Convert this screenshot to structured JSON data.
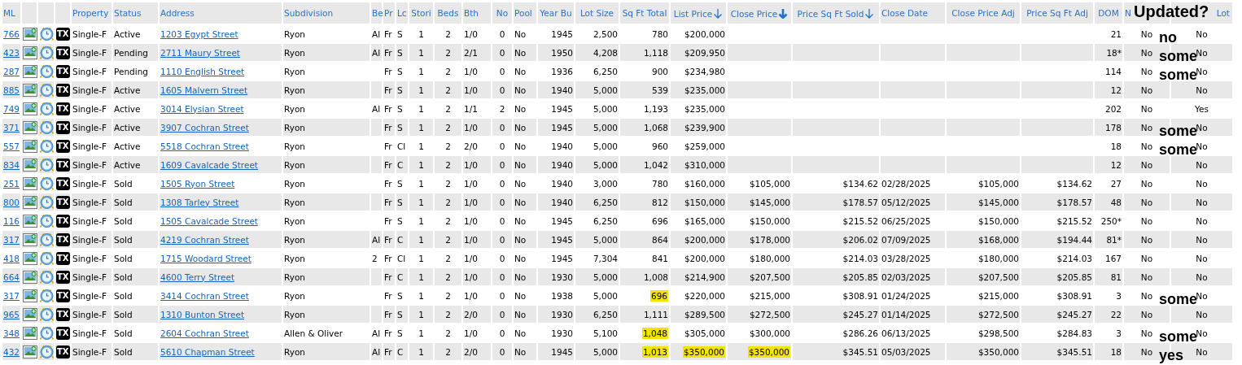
{
  "overlay_title": "Updated?",
  "table": {
    "columns": [
      {
        "label": "ML",
        "kind": "link"
      },
      {
        "kind": "photo"
      },
      {
        "kind": "clock"
      },
      {
        "kind": "badge"
      },
      {
        "label": "Property",
        "kind": "text"
      },
      {
        "label": "Status",
        "kind": "text"
      },
      {
        "label": "Address",
        "kind": "link"
      },
      {
        "label": "Subdivision",
        "kind": "text"
      },
      {
        "label": "Be",
        "kind": "text"
      },
      {
        "label": "Pr",
        "kind": "text"
      },
      {
        "label": "Lc",
        "kind": "text"
      },
      {
        "label": "Stori",
        "kind": "center"
      },
      {
        "label": "Beds",
        "kind": "center"
      },
      {
        "label": "Bth",
        "kind": "text"
      },
      {
        "label": "No",
        "kind": "center"
      },
      {
        "label": "Pool",
        "kind": "text"
      },
      {
        "label": "Year Bu",
        "kind": "num"
      },
      {
        "label": "Lot Size",
        "kind": "num"
      },
      {
        "label": "Sq Ft Total",
        "kind": "num"
      },
      {
        "label": "List Price",
        "kind": "num",
        "sorted": true,
        "primary": false
      },
      {
        "label": "Close Price",
        "kind": "num",
        "sorted": true,
        "primary": true
      },
      {
        "label": "Price Sq Ft Sold",
        "kind": "num",
        "sorted": true,
        "primary": false
      },
      {
        "label": "Close Date",
        "kind": "text"
      },
      {
        "label": "Close Price Adj",
        "kind": "num"
      },
      {
        "label": "Price Sq Ft Adj",
        "kind": "num"
      },
      {
        "label": "DOM",
        "kind": "num"
      },
      {
        "label": "N",
        "kind": "center"
      },
      {
        "label": "Lot",
        "kind": "center"
      }
    ],
    "rows": [
      {
        "cells": [
          "766",
          null,
          null,
          "TX",
          "Single-F",
          "Active",
          "1203 Egypt Street",
          "Ryon",
          "Al",
          "Fr",
          "S",
          "1",
          "2",
          "1/0",
          "0",
          "No",
          "1945",
          "2,500",
          "780",
          "$200,000",
          null,
          null,
          null,
          null,
          null,
          "21",
          "No",
          "No"
        ],
        "note": "no"
      },
      {
        "cells": [
          "423",
          null,
          null,
          "TX",
          "Single-F",
          "Pending",
          "2711 Maury Street",
          "Ryon",
          "Al",
          "Fr",
          "S",
          "1",
          "2",
          "2/1",
          "0",
          "No",
          "1950",
          "4,208",
          "1,118",
          "$209,950",
          null,
          null,
          null,
          null,
          null,
          "18*",
          "No",
          "No"
        ],
        "note": "some"
      },
      {
        "cells": [
          "287",
          null,
          null,
          "TX",
          "Single-F",
          "Pending",
          "1110 English Street",
          "Ryon",
          null,
          "Fr",
          "S",
          "1",
          "2",
          "1/0",
          "0",
          "No",
          "1936",
          "6,250",
          "900",
          "$234,980",
          null,
          null,
          null,
          null,
          null,
          "114",
          "No",
          "No"
        ],
        "note": "some"
      },
      {
        "cells": [
          "885",
          null,
          null,
          "TX",
          "Single-F",
          "Active",
          "1605 Malvern Street",
          "Ryon",
          null,
          "Fr",
          "S",
          "1",
          "2",
          "1/0",
          "0",
          "No",
          "1940",
          "5,000",
          "539",
          "$235,000",
          null,
          null,
          null,
          null,
          null,
          "12",
          "No",
          "No"
        ]
      },
      {
        "cells": [
          "749",
          null,
          null,
          "TX",
          "Single-F",
          "Active",
          "3014 Elysian Street",
          "Ryon",
          "Al",
          "Fr",
          "S",
          "1",
          "2",
          "1/1",
          "2",
          "No",
          "1945",
          "5,000",
          "1,193",
          "$235,000",
          null,
          null,
          null,
          null,
          null,
          "202",
          "No",
          "Yes"
        ]
      },
      {
        "cells": [
          "371",
          null,
          null,
          "TX",
          "Single-F",
          "Active",
          "3907 Cochran Street",
          "Ryon",
          null,
          "Fr",
          "S",
          "1",
          "2",
          "1/0",
          "0",
          "No",
          "1945",
          "5,000",
          "1,068",
          "$239,900",
          null,
          null,
          null,
          null,
          null,
          "178",
          "No",
          "No"
        ],
        "note": "some"
      },
      {
        "cells": [
          "557",
          null,
          null,
          "TX",
          "Single-F",
          "Active",
          "5518 Cochran Street",
          "Ryon",
          null,
          "Fr",
          "Cl",
          "1",
          "2",
          "2/0",
          "0",
          "No",
          "1940",
          "5,000",
          "960",
          "$259,000",
          null,
          null,
          null,
          null,
          null,
          "18",
          "No",
          "No"
        ],
        "note": "some"
      },
      {
        "cells": [
          "834",
          null,
          null,
          "TX",
          "Single-F",
          "Active",
          "1609 Cavalcade Street",
          "Ryon",
          null,
          "Fr",
          "C",
          "1",
          "2",
          "1/0",
          "0",
          "No",
          "1940",
          "5,000",
          "1,042",
          "$310,000",
          null,
          null,
          null,
          null,
          null,
          "12",
          "No",
          "No"
        ]
      },
      {
        "cells": [
          "251",
          null,
          null,
          "TX",
          "Single-F",
          "Sold",
          "1505 Ryon Street",
          "Ryon",
          null,
          "Fr",
          "S",
          "1",
          "2",
          "1/0",
          "0",
          "No",
          "1940",
          "3,000",
          "780",
          "$160,000",
          "$105,000",
          "$134.62",
          "02/28/2025",
          "$105,000",
          "$134.62",
          "27",
          "No",
          "No"
        ]
      },
      {
        "cells": [
          "800",
          null,
          null,
          "TX",
          "Single-F",
          "Sold",
          "1308 Tarley Street",
          "Ryon",
          null,
          "Fr",
          "S",
          "1",
          "2",
          "1/0",
          "0",
          "No",
          "1940",
          "6,250",
          "812",
          "$150,000",
          "$145,000",
          "$178.57",
          "05/12/2025",
          "$145,000",
          "$178.57",
          "48",
          "No",
          "No"
        ]
      },
      {
        "cells": [
          "116",
          null,
          null,
          "TX",
          "Single-F",
          "Sold",
          "1505 Cavalcade Street",
          "Ryon",
          null,
          "Fr",
          "S",
          "1",
          "2",
          "1/0",
          "0",
          "No",
          "1945",
          "6,250",
          "696",
          "$165,000",
          "$150,000",
          "$215.52",
          "06/25/2025",
          "$150,000",
          "$215.52",
          "250*",
          "No",
          "No"
        ]
      },
      {
        "cells": [
          "317",
          null,
          null,
          "TX",
          "Single-F",
          "Sold",
          "4219 Cochran Street",
          "Ryon",
          "Al",
          "Fr",
          "C",
          "1",
          "2",
          "1/0",
          "0",
          "No",
          "1945",
          "5,000",
          "864",
          "$200,000",
          "$178,000",
          "$206.02",
          "07/09/2025",
          "$168,000",
          "$194.44",
          "81*",
          "No",
          "No"
        ]
      },
      {
        "cells": [
          "418",
          null,
          null,
          "TX",
          "Single-F",
          "Sold",
          "1715 Woodard Street",
          "Ryon",
          "2",
          "Fr",
          "Cl",
          "1",
          "2",
          "1/0",
          "0",
          "No",
          "1945",
          "7,304",
          "841",
          "$200,000",
          "$180,000",
          "$214.03",
          "03/28/2025",
          "$180,000",
          "$214.03",
          "167",
          "No",
          "No"
        ]
      },
      {
        "cells": [
          "664",
          null,
          null,
          "TX",
          "Single-F",
          "Sold",
          "4600 Terry Street",
          "Ryon",
          null,
          "Fr",
          "C",
          "1",
          "2",
          "1/0",
          "0",
          "No",
          "1930",
          "5,000",
          "1,008",
          "$214,900",
          "$207,500",
          "$205.85",
          "02/03/2025",
          "$207,500",
          "$205.85",
          "81",
          "No",
          "No"
        ]
      },
      {
        "cells": [
          "317",
          null,
          null,
          "TX",
          "Single-F",
          "Sold",
          "3414 Cochran Street",
          "Ryon",
          null,
          "Fr",
          "S",
          "1",
          "2",
          "1/0",
          "0",
          "No",
          "1938",
          "5,000",
          {
            "text": "696",
            "highlighted": true
          },
          "$220,000",
          "$215,000",
          "$308.91",
          "01/24/2025",
          "$215,000",
          "$308.91",
          "3",
          "No",
          "No"
        ],
        "note": "some"
      },
      {
        "cells": [
          "965",
          null,
          null,
          "TX",
          "Single-F",
          "Sold",
          "1310 Bunton Street",
          "Ryon",
          null,
          "Fr",
          "S",
          "1",
          "2",
          "2/0",
          "0",
          "No",
          "1930",
          "6,250",
          "1,111",
          "$289,500",
          "$272,500",
          "$245.27",
          "01/14/2025",
          "$272,500",
          "$245.27",
          "22",
          "No",
          "No"
        ]
      },
      {
        "cells": [
          "348",
          null,
          null,
          "TX",
          "Single-F",
          "Sold",
          "2604 Cochran Street",
          "Allen & Oliver",
          "Al",
          "Fr",
          "S",
          "1",
          "2",
          "1/0",
          "0",
          "No",
          "1930",
          "5,100",
          {
            "text": "1,048",
            "highlighted": true
          },
          "$305,000",
          "$300,000",
          "$286.26",
          "06/13/2025",
          "$298,500",
          "$284.83",
          "3",
          "No",
          "No"
        ],
        "note": "some"
      },
      {
        "cells": [
          "432",
          null,
          null,
          "TX",
          "Single-F",
          "Sold",
          "5610 Chapman Street",
          "Ryon",
          "Al",
          "Fr",
          "C",
          "1",
          "2",
          "2/0",
          "0",
          "No",
          "1945",
          "5,000",
          {
            "text": "1,013",
            "highlighted": true
          },
          {
            "text": "$350,000",
            "highlighted": true
          },
          {
            "text": "$350,000",
            "highlighted": true
          },
          "$345.51",
          "05/03/2025",
          "$350,000",
          "$345.51",
          "18",
          "No",
          "No"
        ],
        "note": "yes"
      }
    ]
  }
}
